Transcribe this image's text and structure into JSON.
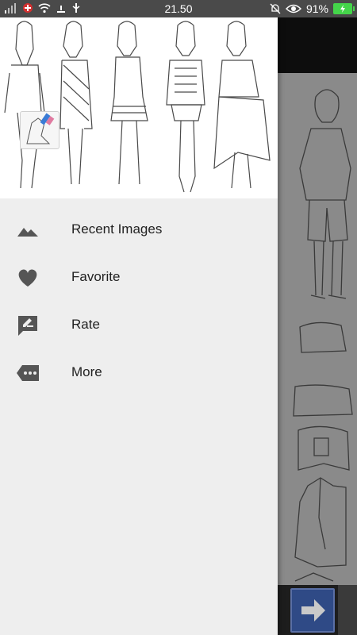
{
  "status_bar": {
    "time": "21.50",
    "battery_percent": "91%"
  },
  "drawer": {
    "menu_items": [
      {
        "label": "Recent Images",
        "icon": "landscape-icon"
      },
      {
        "label": "Favorite",
        "icon": "heart-icon"
      },
      {
        "label": "Rate",
        "icon": "rate-review-icon"
      },
      {
        "label": "More",
        "icon": "more-chat-icon"
      }
    ]
  },
  "colors": {
    "drawer_bg": "#eeeeee",
    "icon": "#555555",
    "status_bar_bg": "#4a4a4a",
    "arrow_button_bg": "#2f4a86",
    "battery": "#44d44a"
  }
}
